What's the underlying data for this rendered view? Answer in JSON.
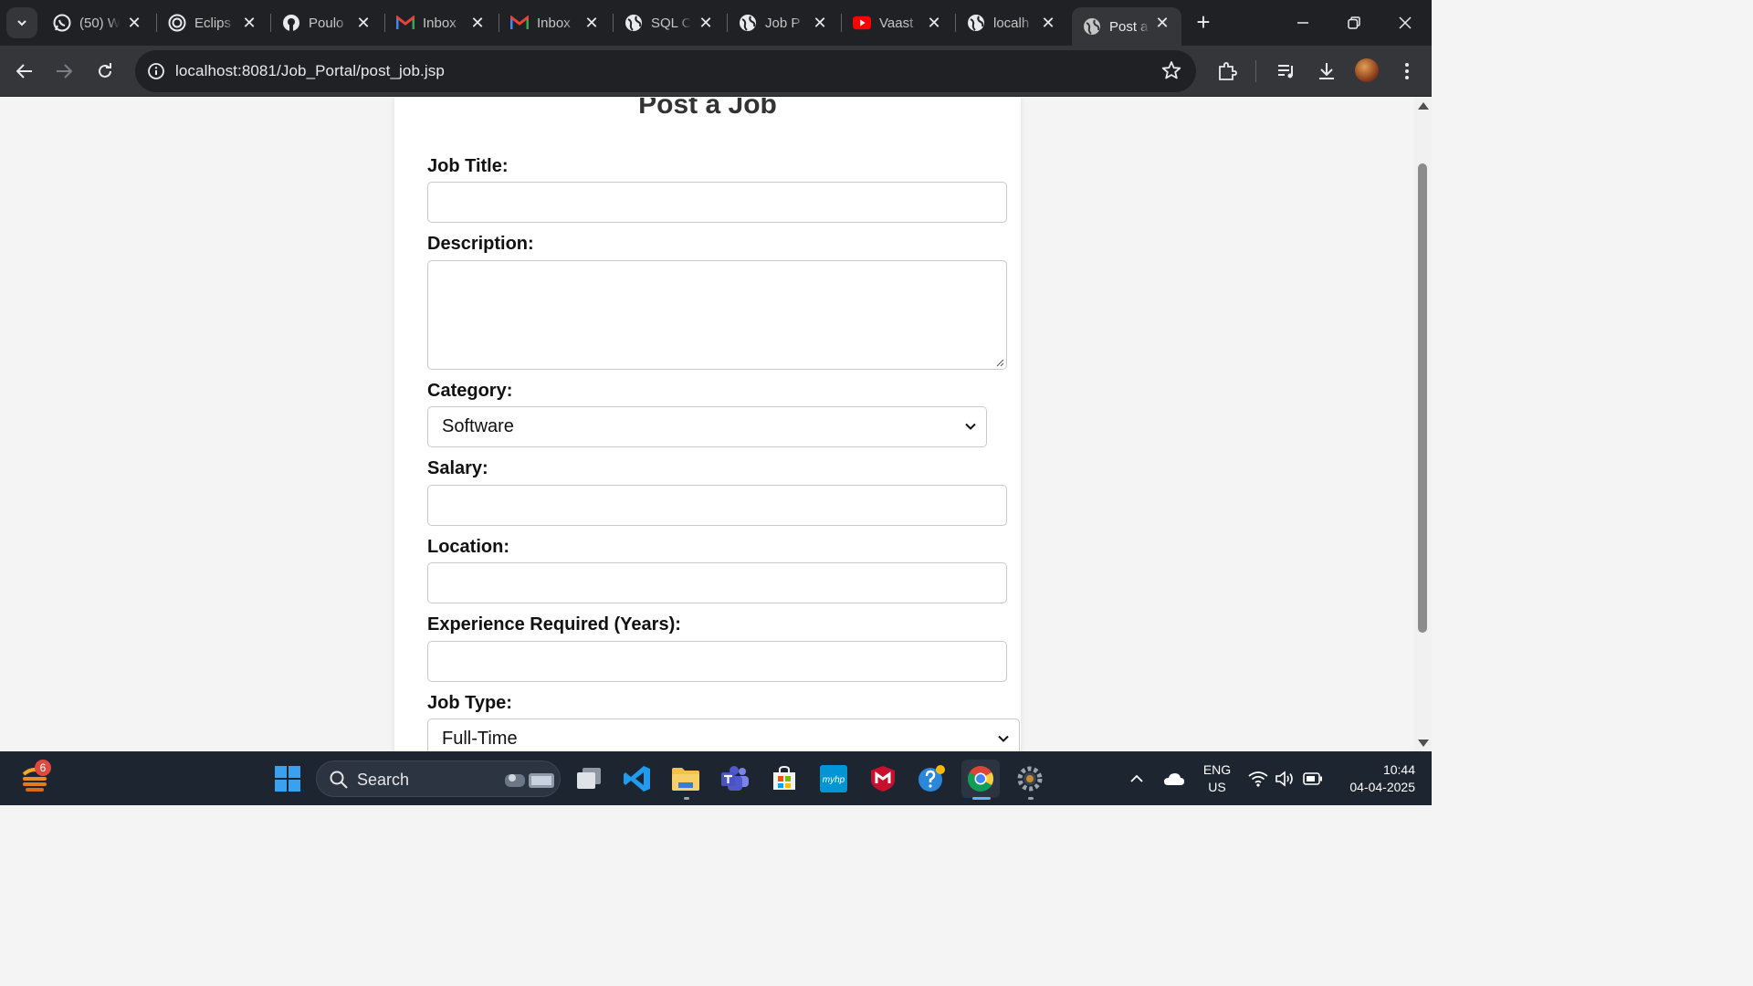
{
  "browser": {
    "tabs": [
      {
        "title": "(50) W",
        "icon": "whatsapp-icon",
        "active": false
      },
      {
        "title": "Eclips",
        "icon": "eclipse-icon",
        "active": false
      },
      {
        "title": "Poulo",
        "icon": "github-icon",
        "active": false
      },
      {
        "title": "Inbox",
        "icon": "gmail-icon",
        "active": false
      },
      {
        "title": "Inbox",
        "icon": "gmail-icon",
        "active": false
      },
      {
        "title": "SQL C",
        "icon": "globe-icon",
        "active": false
      },
      {
        "title": "Job P",
        "icon": "globe-icon",
        "active": false
      },
      {
        "title": "Vaast",
        "icon": "youtube-icon",
        "active": false
      },
      {
        "title": "localh",
        "icon": "globe-icon",
        "active": false
      },
      {
        "title": "Post a",
        "icon": "globe-icon",
        "active": true
      }
    ],
    "url": "localhost:8081/Job_Portal/post_job.jsp"
  },
  "form": {
    "title": "Post a Job",
    "job_title_label": "Job Title:",
    "job_title_value": "",
    "description_label": "Description:",
    "description_value": "",
    "category_label": "Category:",
    "category_selected": "Software",
    "salary_label": "Salary:",
    "salary_value": "",
    "location_label": "Location:",
    "location_value": "",
    "experience_label": "Experience Required (Years):",
    "experience_value": "",
    "job_type_label": "Job Type:",
    "job_type_selected": "Full-Time"
  },
  "taskbar": {
    "search_label": "Search",
    "widgets_badge": "6",
    "language": "ENG",
    "region": "US",
    "time": "10:44",
    "date": "04-04-2025"
  },
  "colors": {
    "tabstrip_bg": "#202124",
    "toolbar_bg": "#35363a",
    "page_bg": "#f4f4f4",
    "card_bg": "#ffffff",
    "taskbar_bg": "#1c2530"
  }
}
